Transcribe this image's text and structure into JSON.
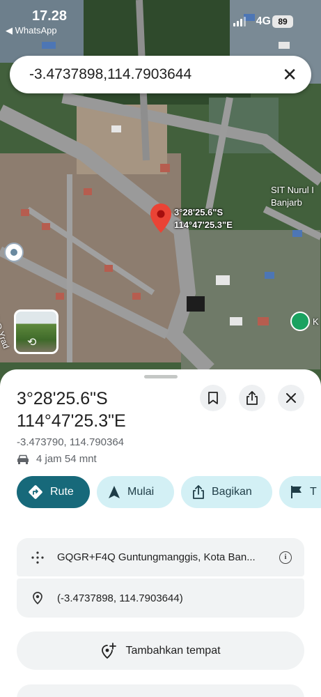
{
  "status_bar": {
    "time": "17.28",
    "back_app": "◀ WhatsApp",
    "network": "4G",
    "battery": "89"
  },
  "search": {
    "query": "-3.4737898,114.7903644"
  },
  "map": {
    "pin_label_lat": "3°28'25.6\"S",
    "pin_label_lng": "114°47'25.3\"E",
    "poi_name_line1": "SIT Nurul I",
    "poi_name_line2": "Banjarb",
    "poi2_label": "K",
    "road_label": "Jl. D  Yrad"
  },
  "place": {
    "title_lat": "3°28'25.6\"S",
    "title_lng": "114°47'25.3\"E",
    "decimal_coords": "-3.473790, 114.790364",
    "drive_time": "4 jam 54 mnt"
  },
  "actions": {
    "route": "Rute",
    "start": "Mulai",
    "share": "Bagikan",
    "more": "T"
  },
  "details": {
    "plus_code": "GQGR+F4Q Guntungmanggis, Kota Ban...",
    "coordinates": "(-3.4737898, 114.7903644)"
  },
  "add_place": {
    "label": "Tambahkan tempat"
  },
  "colors": {
    "route_button": "#17697a",
    "chip_bg": "#d3f0f5",
    "pin_red": "#ea4335",
    "card_bg": "#f1f3f4"
  },
  "icons": {
    "back": "back-arrow-icon",
    "close": "close-icon",
    "bookmark": "bookmark-icon",
    "share": "share-icon",
    "car": "car-icon",
    "route": "directions-icon",
    "start": "navigation-arrow-icon",
    "flag": "flag-icon",
    "plus_code": "plus-code-icon",
    "location": "location-pin-icon",
    "add_place": "add-location-icon",
    "info": "info-icon"
  }
}
